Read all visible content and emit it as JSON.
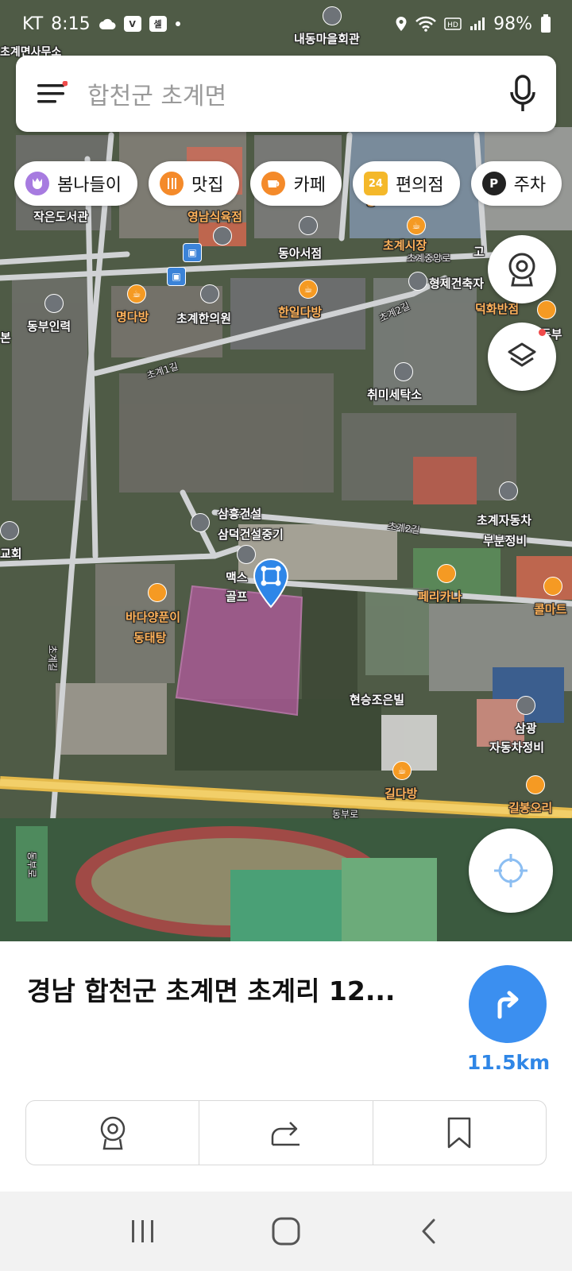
{
  "status_bar": {
    "carrier": "KT",
    "time": "8:15",
    "battery": "98%",
    "icons": [
      "cloud-icon",
      "app-notification-icon",
      "app-notification-icon",
      "dot-icon",
      "location-icon",
      "wifi-icon",
      "hd-icon",
      "signal-icon",
      "battery-icon"
    ]
  },
  "search": {
    "placeholder": "합천군 초계면",
    "menu_icon": "hamburger-menu-icon",
    "mic_icon": "microphone-icon"
  },
  "chips": [
    {
      "label": "봄나들이",
      "icon": "tulip-icon",
      "color": "#a77be0"
    },
    {
      "label": "맛집",
      "icon": "utensils-icon",
      "color": "#f48a2a"
    },
    {
      "label": "카페",
      "icon": "coffee-cup-icon",
      "color": "#f48a2a"
    },
    {
      "label": "편의점",
      "icon": "store-24-icon",
      "color": "#f4b82a",
      "badge": "24"
    },
    {
      "label": "주차",
      "icon": "parking-icon",
      "color": "#222222",
      "badge": "P"
    }
  ],
  "map": {
    "labels": [
      {
        "text": "내동마을회관",
        "kind": "place"
      },
      {
        "text": "초계면사무소",
        "kind": "place"
      },
      {
        "text": "작은도서관",
        "kind": "place"
      },
      {
        "text": "영남식육점",
        "kind": "food"
      },
      {
        "text": "방",
        "kind": "food"
      },
      {
        "text": "초계시장",
        "kind": "food"
      },
      {
        "text": "동아서점",
        "kind": "place"
      },
      {
        "text": "초계중앙로",
        "kind": "road"
      },
      {
        "text": "고",
        "kind": "place"
      },
      {
        "text": "형제건축자",
        "kind": "place"
      },
      {
        "text": "명다방",
        "kind": "food"
      },
      {
        "text": "초계한의원",
        "kind": "place"
      },
      {
        "text": "한일다방",
        "kind": "food"
      },
      {
        "text": "동부인력",
        "kind": "place"
      },
      {
        "text": "덕화반점",
        "kind": "food"
      },
      {
        "text": "초계1길",
        "kind": "road"
      },
      {
        "text": "초계2길",
        "kind": "road"
      },
      {
        "text": "취미세탁소",
        "kind": "place"
      },
      {
        "text": "삼흥건설",
        "kind": "place"
      },
      {
        "text": "삼덕건설중기",
        "kind": "place"
      },
      {
        "text": "초계자동차",
        "kind": "place"
      },
      {
        "text": "부분정비",
        "kind": "place"
      },
      {
        "text": "초계2길",
        "kind": "road"
      },
      {
        "text": "교회",
        "kind": "place"
      },
      {
        "text": "맥스",
        "kind": "place"
      },
      {
        "text": "골프",
        "kind": "place"
      },
      {
        "text": "페리카나",
        "kind": "food"
      },
      {
        "text": "콜마트",
        "kind": "food"
      },
      {
        "text": "바다양푼이",
        "kind": "food"
      },
      {
        "text": "동태탕",
        "kind": "food"
      },
      {
        "text": "현승조은빌",
        "kind": "place"
      },
      {
        "text": "삼광",
        "kind": "place"
      },
      {
        "text": "자동차정비",
        "kind": "place"
      },
      {
        "text": "초계길",
        "kind": "road"
      },
      {
        "text": "길다방",
        "kind": "food"
      },
      {
        "text": "길봉오리",
        "kind": "food"
      },
      {
        "text": "동부로",
        "kind": "road"
      },
      {
        "text": "동부로",
        "kind": "road"
      },
      {
        "text": "본",
        "kind": "place"
      },
      {
        "text": "동부",
        "kind": "place"
      }
    ],
    "buttons": {
      "roadview_icon": "roadview-camera-icon",
      "layers_icon": "layers-icon",
      "locate_icon": "crosshair-locate-icon"
    }
  },
  "place": {
    "address": "경남 합천군 초계면 초계리 12...",
    "distance": "11.5km",
    "route_icon": "turn-right-arrow-icon",
    "actions": [
      {
        "name": "roadview",
        "icon": "roadview-camera-icon"
      },
      {
        "name": "share",
        "icon": "share-icon"
      },
      {
        "name": "bookmark",
        "icon": "bookmark-icon"
      }
    ]
  },
  "nav": {
    "buttons": [
      "recent-apps-icon",
      "home-icon",
      "back-icon"
    ]
  }
}
